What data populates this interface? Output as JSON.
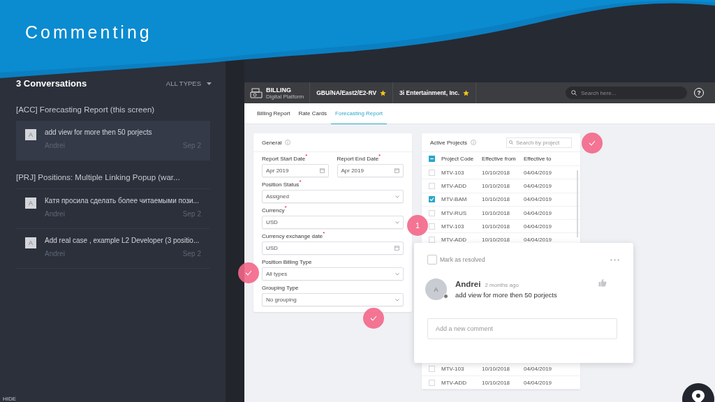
{
  "slide": {
    "title": "Commenting"
  },
  "sidebar": {
    "title": "3 Conversations",
    "filter": "ALL TYPES",
    "hide_label": "HIDE",
    "groups": [
      {
        "title": "[ACC] Forecasting Report (this screen)",
        "conversations": [
          {
            "avatar": "A",
            "text": "add view for more then 50 porjects",
            "author": "Andrei",
            "date": "Sep 2",
            "selected": true
          }
        ]
      },
      {
        "title": "[PRJ] Positions: Multiple Linking Popup (war...",
        "conversations": [
          {
            "avatar": "A",
            "text": "Катя просила сделать более читаемыми пози...",
            "author": "Andrei",
            "date": "Sep 2",
            "selected": false
          },
          {
            "avatar": "A",
            "text": "Add real case , example L2 Developer (3 positio...",
            "author": "Andrei",
            "date": "Sep 2",
            "selected": false
          }
        ]
      }
    ]
  },
  "app": {
    "brand": {
      "name": "BILLING",
      "subtitle": "Digital Platform"
    },
    "breadcrumbs": [
      {
        "label": "GBU/NA/East2/E2-RV",
        "starred": true
      },
      {
        "label": "3i Entertainment, Inc.",
        "starred": true
      }
    ],
    "search": {
      "placeholder": "Search here..."
    },
    "help": "?",
    "tabs": [
      {
        "label": "Billing Report",
        "selected": false
      },
      {
        "label": "Rate Cards",
        "selected": false
      },
      {
        "label": "Forecasting Report",
        "selected": true
      }
    ],
    "general": {
      "title": "General",
      "rows": [
        [
          {
            "label": "Report Start Date$^{*}$",
            "value": "Apr 2019",
            "kind": "date"
          },
          {
            "label": "Report End Date$^{*}$",
            "value": "Apr 2019",
            "kind": "date"
          }
        ],
        [
          {
            "label": "Position Status$^{*}$",
            "value": "Assigned",
            "kind": "select"
          }
        ],
        [
          {
            "label": "Currency$^{*}$",
            "value": "USD",
            "kind": "select"
          }
        ],
        [
          {
            "label": "Currency exchange date$^{*}$",
            "value": "USD",
            "kind": "date"
          }
        ],
        [
          {
            "label": "Position Billing Type",
            "value": "All types",
            "kind": "select"
          }
        ],
        [
          {
            "label": "Grouping Type",
            "value": "No grouping",
            "kind": "select"
          }
        ]
      ]
    },
    "projects": {
      "title": "Active Projects",
      "search_placeholder": "Search by project",
      "select_all_checked": true,
      "select_all_partial": true,
      "columns": [
        "Project Code",
        "Effective from",
        "Effective to"
      ],
      "rows": [
        {
          "code": "MTV-103",
          "from": "10/10/2018",
          "to": "04/04/2019",
          "checked": false
        },
        {
          "code": "MTV-ADD",
          "from": "10/10/2018",
          "to": "04/04/2019",
          "checked": false
        },
        {
          "code": "MTV-BAM",
          "from": "10/10/2018",
          "to": "04/04/2019",
          "checked": true
        },
        {
          "code": "MTV-RUS",
          "from": "10/10/2018",
          "to": "04/04/2019",
          "checked": false
        },
        {
          "code": "MTV-103",
          "from": "10/10/2018",
          "to": "04/04/2019",
          "checked": false
        },
        {
          "code": "MTV-ADD",
          "from": "10/10/2018",
          "to": "04/04/2019",
          "checked": false
        }
      ],
      "rows_below": [
        {
          "code": "MTV-103",
          "from": "10/10/2018",
          "to": "04/04/2019",
          "checked": false
        },
        {
          "code": "MTV-ADD",
          "from": "10/10/2018",
          "to": "04/04/2019",
          "checked": false
        }
      ]
    },
    "comment": {
      "resolve_label": "Mark as resolved",
      "resolved": false,
      "avatar": "A",
      "author": "Andrei",
      "time": "2 months ago",
      "online": true,
      "text": "add view for more then 50 porjects",
      "reply_placeholder": "Add a new comment"
    }
  },
  "markers": [
    {
      "kind": "check"
    },
    {
      "kind": "check"
    },
    {
      "kind": "check"
    },
    {
      "kind": "number",
      "label": "1"
    }
  ]
}
